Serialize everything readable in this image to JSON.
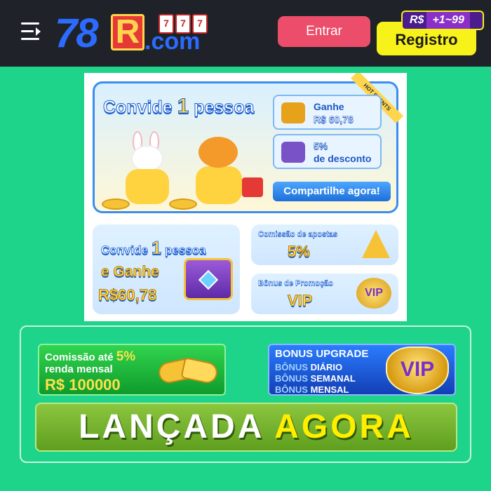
{
  "header": {
    "menu_icon": "menu-icon",
    "logo": {
      "num": "78",
      "letter": "R",
      "domain": ".com",
      "slots": [
        "7",
        "7",
        "7"
      ]
    },
    "login_label": "Entrar",
    "register_label": "Registro",
    "register_badge": {
      "currency": "R$",
      "range": "+1~99"
    }
  },
  "banner": {
    "main": {
      "title_prefix": "Convide",
      "title_num": "1",
      "title_suffix": "pessoa",
      "hot_label": "HOT EVENTS",
      "reward_box": {
        "line1": "Ganhe",
        "line2": "R$ 60,78",
        "icon": "treasure-chest-icon"
      },
      "discount_box": {
        "line1": "5%",
        "line2": "de desconto",
        "icon": "wallet-icon"
      },
      "share_label": "Compartilhe agora!"
    },
    "left_card": {
      "line1_prefix": "Convide",
      "line1_num": "1",
      "line1_suffix": "pessoa",
      "line2": "e Ganhe",
      "line3": "R$60,78"
    },
    "right_card_1": {
      "small": "Comissão de apostas",
      "big": "5%"
    },
    "right_card_2": {
      "small": "Bônus de Promoção",
      "big": "VIP",
      "badge": "VIP"
    }
  },
  "promo": {
    "left": {
      "line1_prefix": "Comissão até",
      "line1_pct": "5%",
      "line2": "renda mensal",
      "line3": "R$ 100000"
    },
    "right": {
      "title": "BONUS UPGRADE",
      "lines": [
        {
          "a": "BÔNUS",
          "b": "DIÁRIO"
        },
        {
          "a": "BÔNUS",
          "b": "SEMANAL"
        },
        {
          "a": "BÔNUS",
          "b": "MENSAL"
        }
      ],
      "badge": "VIP"
    },
    "launch": {
      "word1": "LANÇADA",
      "word2": "AGORA"
    }
  },
  "colors": {
    "page_bg": "#1ed38a",
    "header_bg": "#1f2329",
    "login_bg": "#eb4d6a",
    "register_bg": "#f7f21a",
    "share_bg": "#1e6fd9",
    "launch_bg": "#6fae2b",
    "launch_accent": "#ffee00"
  }
}
